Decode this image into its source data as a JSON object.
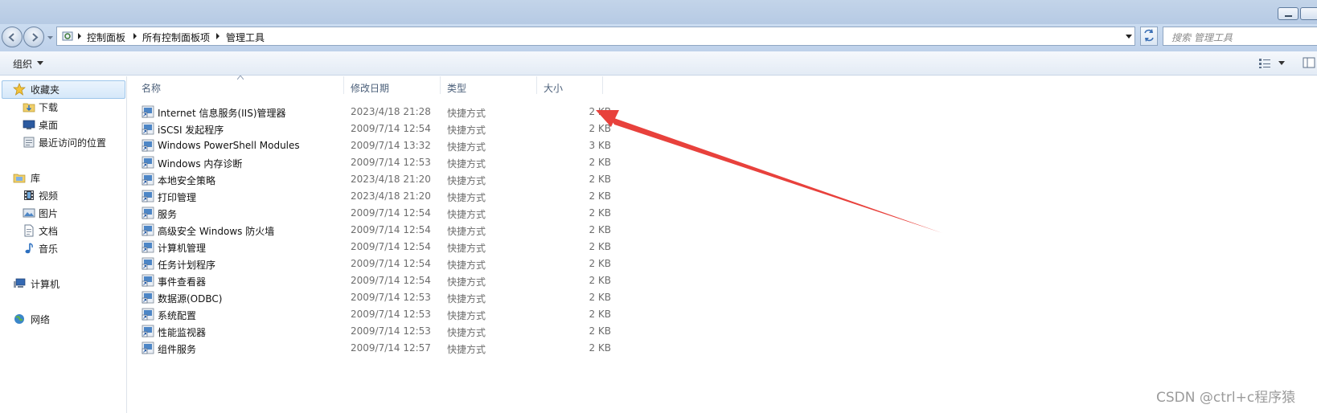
{
  "address": {
    "crumbs": [
      "控制面板",
      "所有控制面板项",
      "管理工具"
    ]
  },
  "search": {
    "placeholder": "搜索 管理工具"
  },
  "toolbar": {
    "organize_label": "组织"
  },
  "sidebar": {
    "favorites": {
      "label": "收藏夹",
      "items": [
        "下载",
        "桌面",
        "最近访问的位置"
      ]
    },
    "library": {
      "label": "库",
      "items": [
        "视频",
        "图片",
        "文档",
        "音乐"
      ]
    },
    "computer": {
      "label": "计算机"
    },
    "network": {
      "label": "网络"
    }
  },
  "columns": {
    "name": "名称",
    "date": "修改日期",
    "type": "类型",
    "size": "大小"
  },
  "files": [
    {
      "name": "Internet 信息服务(IIS)管理器",
      "date": "2023/4/18 21:28",
      "type": "快捷方式",
      "size": "2 KB"
    },
    {
      "name": "iSCSI 发起程序",
      "date": "2009/7/14 12:54",
      "type": "快捷方式",
      "size": "2 KB"
    },
    {
      "name": "Windows PowerShell Modules",
      "date": "2009/7/14 13:32",
      "type": "快捷方式",
      "size": "3 KB"
    },
    {
      "name": "Windows 内存诊断",
      "date": "2009/7/14 12:53",
      "type": "快捷方式",
      "size": "2 KB"
    },
    {
      "name": "本地安全策略",
      "date": "2023/4/18 21:20",
      "type": "快捷方式",
      "size": "2 KB"
    },
    {
      "name": "打印管理",
      "date": "2023/4/18 21:20",
      "type": "快捷方式",
      "size": "2 KB"
    },
    {
      "name": "服务",
      "date": "2009/7/14 12:54",
      "type": "快捷方式",
      "size": "2 KB"
    },
    {
      "name": "高级安全 Windows 防火墙",
      "date": "2009/7/14 12:54",
      "type": "快捷方式",
      "size": "2 KB"
    },
    {
      "name": "计算机管理",
      "date": "2009/7/14 12:54",
      "type": "快捷方式",
      "size": "2 KB"
    },
    {
      "name": "任务计划程序",
      "date": "2009/7/14 12:54",
      "type": "快捷方式",
      "size": "2 KB"
    },
    {
      "name": "事件查看器",
      "date": "2009/7/14 12:54",
      "type": "快捷方式",
      "size": "2 KB"
    },
    {
      "name": "数据源(ODBC)",
      "date": "2009/7/14 12:53",
      "type": "快捷方式",
      "size": "2 KB"
    },
    {
      "name": "系统配置",
      "date": "2009/7/14 12:53",
      "type": "快捷方式",
      "size": "2 KB"
    },
    {
      "name": "性能监视器",
      "date": "2009/7/14 12:53",
      "type": "快捷方式",
      "size": "2 KB"
    },
    {
      "name": "组件服务",
      "date": "2009/7/14 12:57",
      "type": "快捷方式",
      "size": "2 KB"
    }
  ],
  "annotation_color": "#e8413c",
  "watermark": "CSDN @ctrl+c程序猿"
}
